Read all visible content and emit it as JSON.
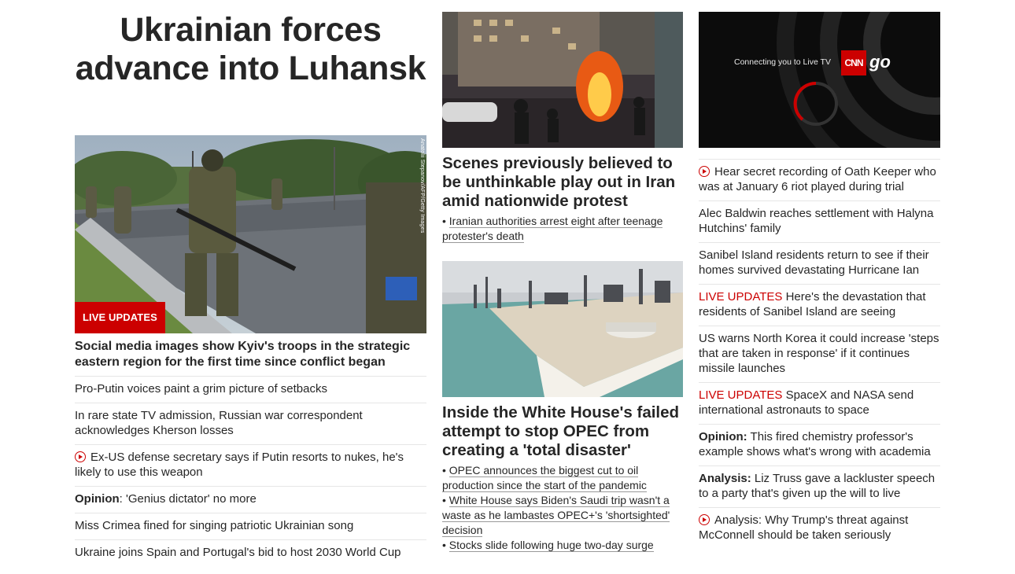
{
  "main_story": {
    "headline": "Ukrainian forces advance into Luhansk",
    "badge": "LIVE UPDATES",
    "photo_credit": "Anatolii Stepanov/AFP/Getty Images",
    "caption": "Social media images show Kyiv's troops in the strategic eastern region for the first time since conflict began",
    "related": [
      {
        "text": "Pro-Putin voices paint a grim picture of setbacks"
      },
      {
        "text": "In rare state TV admission, Russian war correspondent acknowledges Kherson losses"
      },
      {
        "text": "Ex-US defense secretary says if Putin resorts to nukes, he's likely to use this weapon",
        "icon": "play-icon"
      },
      {
        "prefix": "Opinion",
        "text": ": 'Genius dictator' no more"
      },
      {
        "text": "Miss Crimea fined for singing patriotic Ukrainian song"
      },
      {
        "text": "Ukraine joins Spain and Portugal's bid to host 2030 World Cup"
      }
    ]
  },
  "iran_story": {
    "title": "Scenes previously believed to be unthinkable play out in Iran amid nationwide protest",
    "bullets": [
      "Iranian authorities arrest eight after teenage protester's death"
    ]
  },
  "opec_story": {
    "title": "Inside the White House's failed attempt to stop OPEC from creating a 'total disaster'",
    "bullets": [
      "OPEC announces the biggest cut to oil production since the start of the pandemic",
      "White House says Biden's Saudi trip wasn't a waste as he lambastes OPEC+'s 'shortsighted' decision",
      "Stocks slide following huge two-day surge"
    ]
  },
  "live_tv": {
    "connecting_text": "Connecting you to Live TV",
    "logo_text": "CNN",
    "go_text": "go"
  },
  "sidebar": [
    {
      "icon": "play-icon",
      "text": "Hear secret recording of Oath Keeper who was at January 6 riot played during trial"
    },
    {
      "text": "Alec Baldwin reaches settlement with Halyna Hutchins' family"
    },
    {
      "text": "Sanibel Island residents return to see if their homes survived devastating Hurricane Ian"
    },
    {
      "live": "LIVE UPDATES",
      "text": " Here's the devastation that residents of Sanibel Island are seeing"
    },
    {
      "text": "US warns North Korea it could increase 'steps that are taken in response' if it continues missile launches"
    },
    {
      "live": "LIVE UPDATES",
      "text": " SpaceX and NASA send international astronauts to space"
    },
    {
      "prefix": "Opinion:",
      "text": " This fired chemistry professor's example shows what's wrong with academia"
    },
    {
      "prefix": "Analysis:",
      "text": " Liz Truss gave a lackluster speech to a party that's given up the will to live"
    },
    {
      "icon": "play-icon",
      "text": "Analysis: Why Trump's threat against McConnell should be taken seriously"
    }
  ],
  "colors": {
    "accent": "#cc0000",
    "text": "#262626",
    "divider": "#e6e6e6"
  }
}
